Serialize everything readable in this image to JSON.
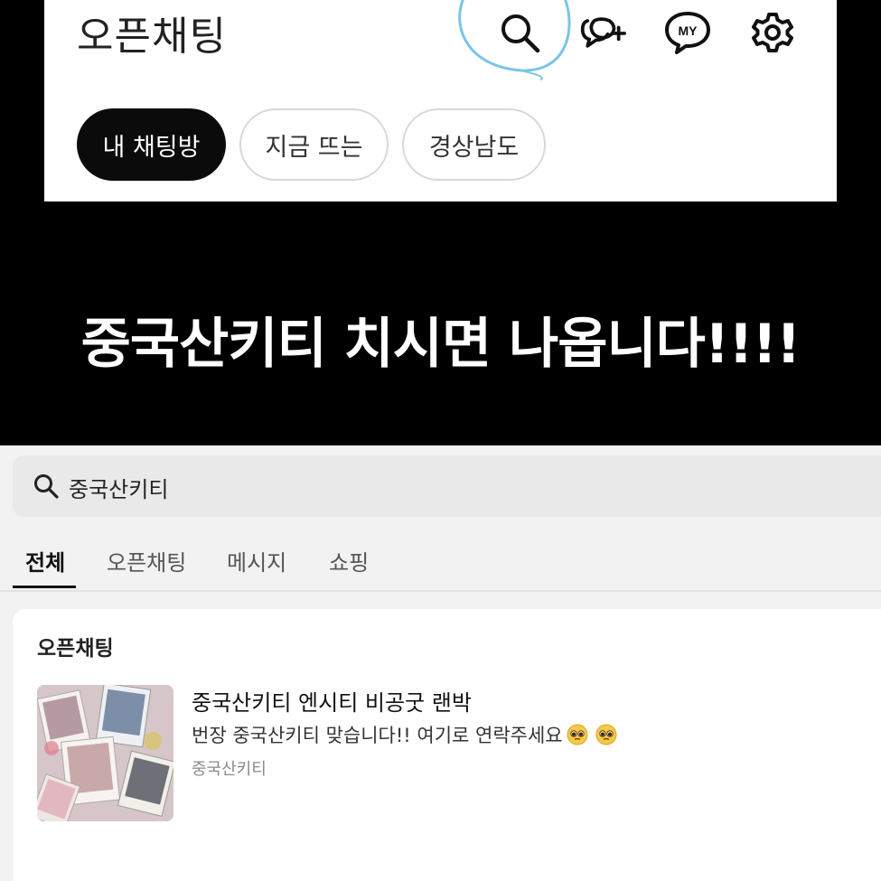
{
  "top": {
    "title": "오픈채팅",
    "icons": [
      "search-icon",
      "new-chat-icon",
      "my-icon",
      "gear-icon"
    ],
    "my_label": "MY",
    "chips": [
      {
        "label": "내 채팅방",
        "active": true
      },
      {
        "label": "지금 뜨는",
        "active": false
      },
      {
        "label": "경상남도",
        "active": false
      }
    ]
  },
  "banner": {
    "caption": "중국산키티 치시면 나옵니다!!!!"
  },
  "search": {
    "query": "중국산키티"
  },
  "tabs": [
    {
      "label": "전체",
      "active": true
    },
    {
      "label": "오픈채팅",
      "active": false
    },
    {
      "label": "메시지",
      "active": false
    },
    {
      "label": "쇼핑",
      "active": false
    }
  ],
  "results": {
    "section_title": "오픈채팅",
    "room": {
      "title": "중국산키티 엔시티 비공굿 랜박",
      "description": "번장 중국산키티 맞습니다!! 여기로 연락주세요",
      "tag": "중국산키티"
    }
  },
  "colors": {
    "background": "#000000",
    "chip_active": "#0b0b0b",
    "annotation": "#7cc4e6",
    "search_bg": "#e9e9e9"
  }
}
